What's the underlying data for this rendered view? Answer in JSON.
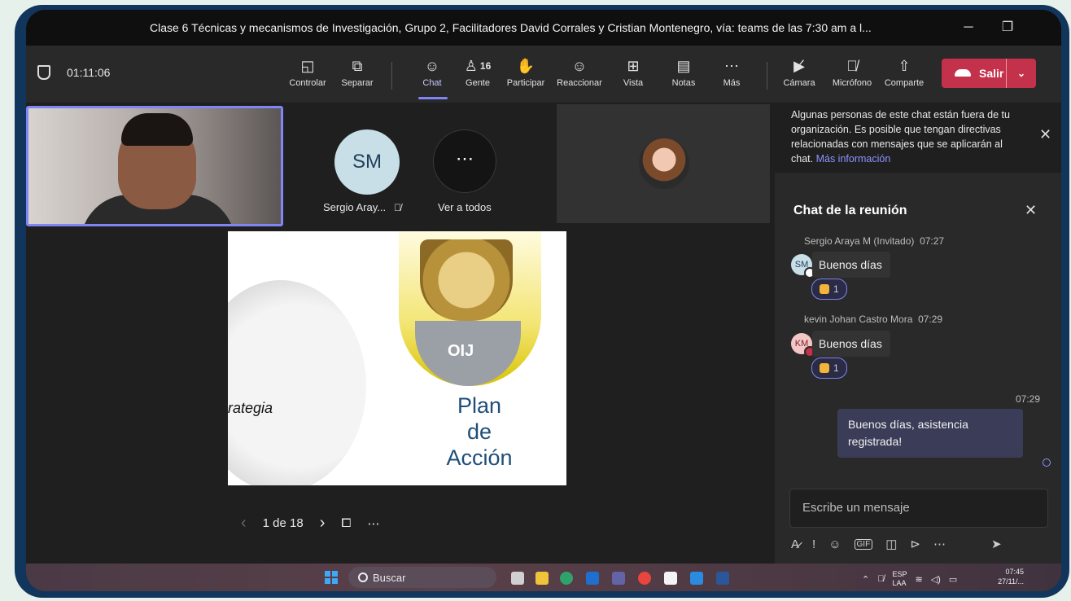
{
  "window": {
    "title": "Clase 6 Técnicas y mecanismos de Investigación,  Grupo 2, Facilitadores David Corrales y Cristian Montenegro, vía: teams de las 7:30  am a l...",
    "minimize": "─",
    "restore": "❐"
  },
  "toolbar": {
    "timer": "01:11:06",
    "controlar": "Controlar",
    "separar": "Separar",
    "chat": "Chat",
    "gente": "Gente",
    "gente_count": "16",
    "participar": "Participar",
    "reaccionar": "Reaccionar",
    "vista": "Vista",
    "notas": "Notas",
    "mas": "Más",
    "camara": "Cámara",
    "microfono": "Micrófono",
    "comparte": "Comparte",
    "salir": "Salir"
  },
  "participants": {
    "sm_initials": "SM",
    "sm_name": "Sergio Aray...",
    "ver_todos": "Ver a todos"
  },
  "slide": {
    "badge_text": "OIJ",
    "doodle_text": "rategia",
    "title_lines": [
      "Plan",
      "de",
      "Acción"
    ],
    "pager": "1 de 18"
  },
  "chat": {
    "notice": "Algunas personas de este chat están fuera de tu organización. Es posible que tengan directivas relacionadas con mensajes que se aplicarán al chat.",
    "notice_link": "Más información",
    "title": "Chat de la reunión",
    "messages": [
      {
        "author": "Sergio Araya M (Invitado)",
        "time": "07:27",
        "initials": "SM",
        "text": "Buenos días",
        "reaction_count": "1",
        "avatar_color": "#c9dfe8",
        "status_color": "#ffffff"
      },
      {
        "author": "kevin Johan Castro Mora",
        "time": "07:29",
        "initials": "KM",
        "text": "Buenos días",
        "reaction_count": "1",
        "avatar_color": "#f4c7c7",
        "status_color": "#c4314b"
      }
    ],
    "my_time": "07:29",
    "my_text": "Buenos días, asistencia registrada!",
    "composer_placeholder": "Escribe un mensaje"
  },
  "taskbar": {
    "search": "Buscar",
    "lang": "ESP",
    "lang_sub": "LAA",
    "time": "07:45",
    "date": "27/11/..."
  },
  "colors": {
    "accent": "#7f85f5",
    "leave": "#c4314b"
  }
}
